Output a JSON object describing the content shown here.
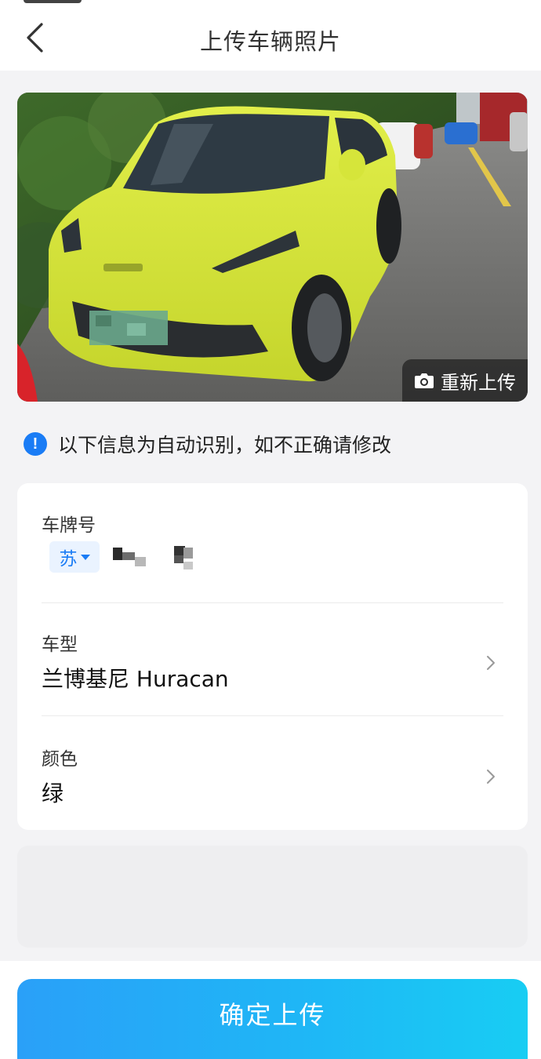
{
  "header": {
    "title": "上传车辆照片"
  },
  "photo": {
    "reupload_label": "重新上传"
  },
  "notice": {
    "text": "以下信息为自动识别，如不正确请修改"
  },
  "form": {
    "plate": {
      "label": "车牌号",
      "province": "苏"
    },
    "model": {
      "label": "车型",
      "value": "兰博基尼 Huracan"
    },
    "color": {
      "label": "颜色",
      "value": "绿"
    }
  },
  "footer": {
    "confirm_label": "确定上传"
  },
  "colors": {
    "accent": "#1a7cf5",
    "button_gradient_start": "#2aa0f8",
    "button_gradient_end": "#18cdf3",
    "car_body": "#d4e43a"
  }
}
